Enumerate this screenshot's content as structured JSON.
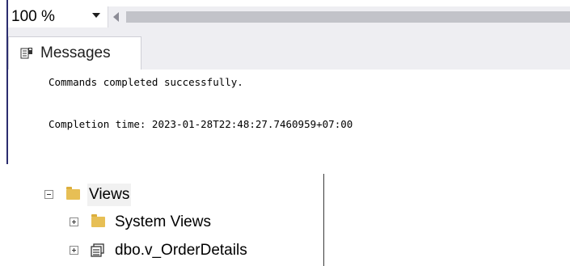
{
  "zoom": {
    "value": "100 %"
  },
  "results": {
    "tab_label": "Messages",
    "tab_icon": "messages-icon",
    "lines": [
      "Commands completed successfully.",
      "Completion time: 2023-01-28T22:48:27.7460959+07:00"
    ]
  },
  "tree": {
    "items": [
      {
        "label": "Views",
        "icon": "folder-icon",
        "expander": "collapse",
        "level": 0
      },
      {
        "label": "System Views",
        "icon": "folder-icon",
        "expander": "expand",
        "level": 1
      },
      {
        "label": "dbo.v_OrderDetails",
        "icon": "view-icon",
        "expander": "expand",
        "level": 1
      }
    ]
  },
  "colors": {
    "panel_chrome": "#eeeef2",
    "folder": "#e7bf55",
    "left_border": "#2b2d6e"
  }
}
